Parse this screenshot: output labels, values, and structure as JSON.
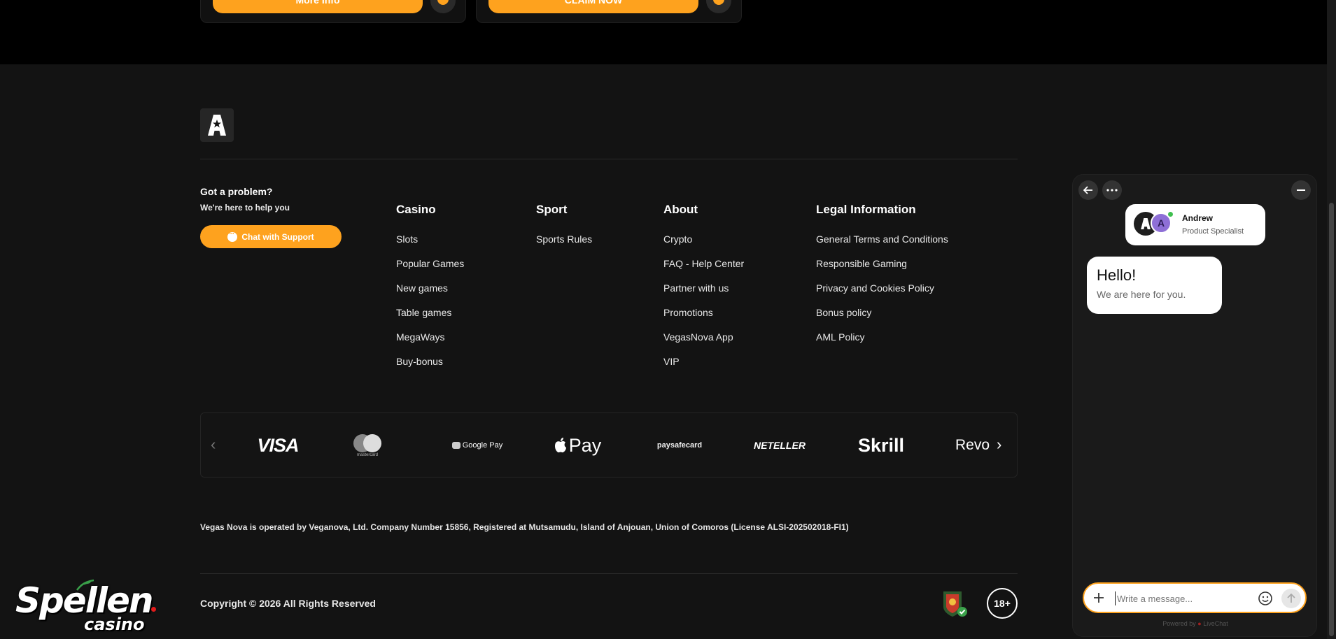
{
  "promo": {
    "cards": [
      {
        "button_label": "More Info"
      },
      {
        "button_label": "CLAIM NOW"
      }
    ]
  },
  "help": {
    "title": "Got a problem?",
    "subtitle": "We're here to help you",
    "chat_button": "Chat with Support"
  },
  "columns": [
    {
      "title": "Casino",
      "links": [
        "Slots",
        "Popular Games",
        "New games",
        "Table games",
        "MegaWays",
        "Buy-bonus"
      ]
    },
    {
      "title": "Sport",
      "links": [
        "Sports Rules"
      ]
    },
    {
      "title": "About",
      "links": [
        "Crypto",
        "FAQ - Help Center",
        "Partner with us",
        "Promotions",
        "VegasNova App",
        "VIP"
      ]
    },
    {
      "title": "Legal Information",
      "links": [
        "General Terms and Conditions",
        "Responsible Gaming",
        "Privacy and Cookies Policy",
        "Bonus policy",
        "AML Policy"
      ]
    }
  ],
  "payments": [
    "VISA",
    "mastercard",
    "Google Pay",
    "Pay",
    "paysafecard",
    "NETELLER",
    "Skrill",
    "Revo"
  ],
  "legal_text": "Vegas Nova is operated by Veganova, Ltd. Company Number 15856, Registered at Mutsamudu, Island of Anjouan, Union of Comoros (License ALSI-202502018-FI1)",
  "copyright": "Copyright © 2026 All Rights Reserved",
  "age_badge": "18+",
  "watermark": {
    "main": "Spellen",
    "sub": "casino"
  },
  "chat": {
    "agent_name": "Andrew",
    "agent_role": "Product Specialist",
    "message_title": "Hello!",
    "message_body": "We are here for you.",
    "input_placeholder": "Write a message...",
    "powered_by": "Powered by",
    "powered_brand": "LiveChat"
  },
  "colors": {
    "accent": "#fea21e",
    "footer_bg": "#131313",
    "chat_bg": "#1a1a1a"
  }
}
